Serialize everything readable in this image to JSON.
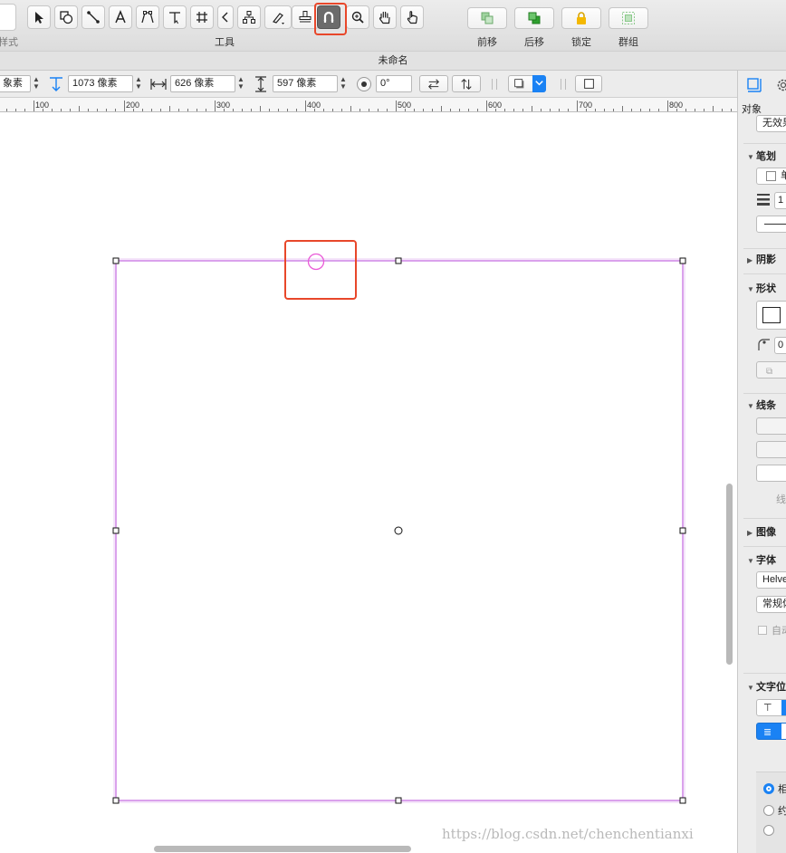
{
  "toolbar": {
    "style_label": "样式",
    "tools_label": "工具",
    "arrange": [
      {
        "label": "前移",
        "dim": true
      },
      {
        "label": "后移",
        "dim": false
      },
      {
        "label": "锁定",
        "dim": false
      },
      {
        "label": "群组",
        "dim": true
      }
    ]
  },
  "window": {
    "title": "未命名"
  },
  "inspector_bar": {
    "x_unit": "象素",
    "y_value": "1073 像素",
    "width_value": "626 像素",
    "height_value": "597 像素",
    "rotation_value": "0°"
  },
  "ruler": {
    "labels": [
      "100",
      "200",
      "300",
      "400",
      "500",
      "600",
      "700",
      "800"
    ]
  },
  "watermark": "https://blog.csdn.net/chenchentianxi",
  "panel": {
    "tab_label": "对象",
    "fill_value": "无效果",
    "stroke_header": "笔划",
    "stroke_type": "单",
    "stroke_width": "1",
    "shadow_header": "阴影",
    "shape_header": "形状",
    "corner_value": "0",
    "lines_header": "线条",
    "lines_label": "线",
    "image_header": "图像",
    "font_header": "字体",
    "font_name": "Helvetica",
    "font_style": "常规体",
    "font_auto": "自动",
    "text_position_header": "文字位置",
    "radio_1": "相",
    "radio_2": "约"
  },
  "colors": {
    "accent_highlight": "#e8472a",
    "selection": "#c163e0",
    "blue": "#1a82f4"
  }
}
